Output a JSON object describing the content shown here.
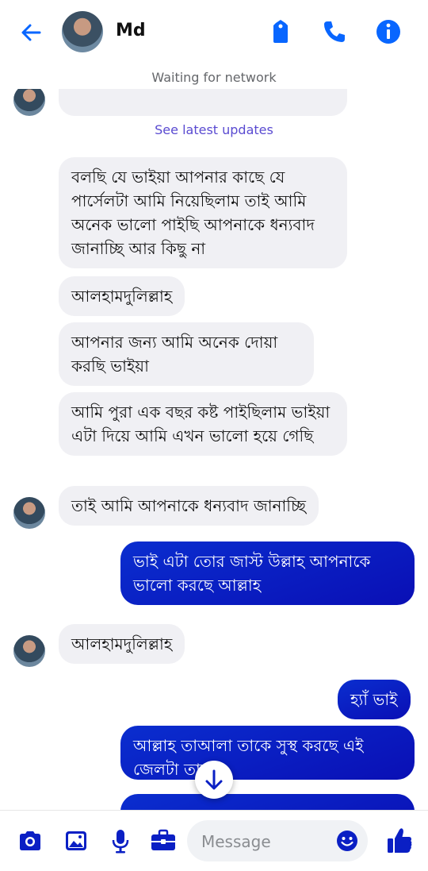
{
  "header": {
    "contact_name": "Md",
    "status": "Waiting for network"
  },
  "chat": {
    "see_updates": "See latest updates",
    "messages": [
      {
        "dir": "in",
        "text": "বলছি যে ভাইয়া আপনার কাছে যে পার্সেলটা আমি নিয়েছিলাম তাই আমি অনেক ভালো পাইছি আপনাকে ধন্যবাদ জানাচ্ছি আর কিছু না"
      },
      {
        "dir": "in",
        "text": "আলহামদুলিল্লাহ"
      },
      {
        "dir": "in",
        "text": "আপনার জন্য আমি অনেক দোয়া করছি ভাইয়া"
      },
      {
        "dir": "in",
        "text": "আমি পুরা এক বছর কষ্ট পাইছিলাম ভাইয়া এটা দিয়ে আমি এখন ভালো হয়ে গেছি"
      },
      {
        "dir": "in",
        "text": "তাই আমি আপনাকে ধন্যবাদ জানাচ্ছি"
      },
      {
        "dir": "out",
        "text": "ভাই এটা তোর জাস্ট উল্লাহ আপনাকে ভালো করছে আল্লাহ"
      },
      {
        "dir": "in",
        "text": "আলহামদুলিল্লাহ"
      },
      {
        "dir": "out",
        "text": "হ্যাঁ ভাই"
      },
      {
        "dir": "out",
        "text": "আল্লাহ তাআলা তাকে সুস্থ করছে এই জেলটা তাকে"
      }
    ]
  },
  "composer": {
    "placeholder": "Message"
  },
  "colors": {
    "accent": "#0866ff",
    "outgoing_bubble": "#0a1fc4",
    "incoming_bubble": "#f0f0f4"
  },
  "icons": [
    "back-arrow-icon",
    "tag-icon",
    "phone-icon",
    "info-icon",
    "camera-icon",
    "image-icon",
    "microphone-icon",
    "briefcase-icon",
    "emoji-icon",
    "thumbs-up-icon",
    "arrow-down-icon"
  ]
}
